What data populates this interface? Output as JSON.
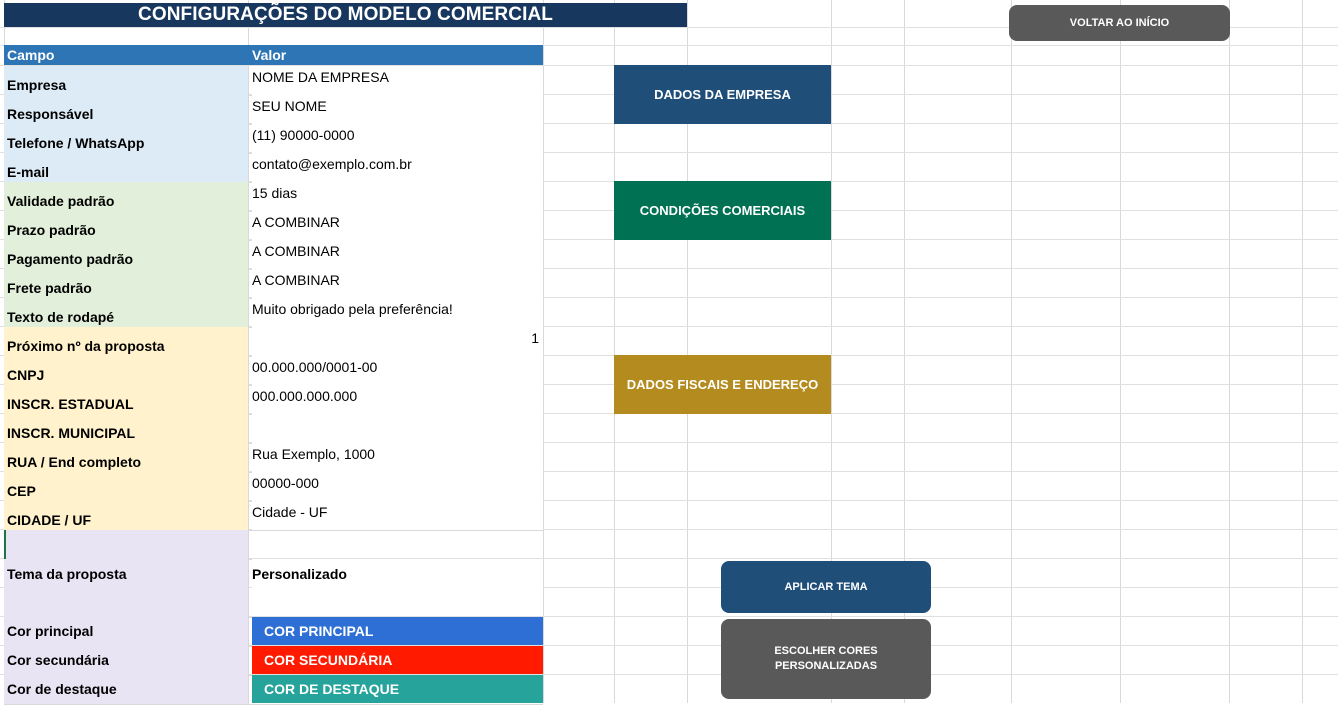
{
  "title": "CONFIGURAÇÕES DO MODELO COMERCIAL",
  "header": {
    "campo": "Campo",
    "valor": "Valor"
  },
  "fields": [
    {
      "label": "Empresa",
      "value": "NOME DA EMPRESA",
      "group": "blue"
    },
    {
      "label": "Responsável",
      "value": "SEU NOME",
      "group": "blue"
    },
    {
      "label": "Telefone / WhatsApp",
      "value": "(11) 90000-0000",
      "group": "blue"
    },
    {
      "label": "E-mail",
      "value": "contato@exemplo.com.br",
      "group": "blue"
    },
    {
      "label": "Validade padrão",
      "value": "15 dias",
      "group": "green"
    },
    {
      "label": "Prazo padrão",
      "value": "A COMBINAR",
      "group": "green"
    },
    {
      "label": "Pagamento padrão",
      "value": "A COMBINAR",
      "group": "green"
    },
    {
      "label": "Frete padrão",
      "value": "A COMBINAR",
      "group": "green"
    },
    {
      "label": "Texto de rodapé",
      "value": "Muito obrigado pela preferência!",
      "group": "green"
    },
    {
      "label": "Próximo nº da proposta",
      "value": "1",
      "group": "yellow"
    },
    {
      "label": "CNPJ",
      "value": "00.000.000/0001-00",
      "group": "yellow"
    },
    {
      "label": "INSCR. ESTADUAL",
      "value": "000.000.000.000",
      "group": "yellow"
    },
    {
      "label": "INSCR. MUNICIPAL",
      "value": "",
      "group": "yellow"
    },
    {
      "label": "RUA / End completo",
      "value": "Rua Exemplo, 1000",
      "group": "yellow"
    },
    {
      "label": "CEP",
      "value": "00000-000",
      "group": "yellow"
    },
    {
      "label": "CIDADE / UF",
      "value": "Cidade - UF",
      "group": "yellow"
    }
  ],
  "theme": {
    "label": "Tema da proposta",
    "value": "Personalizado"
  },
  "colors": [
    {
      "label": "Cor principal",
      "value": "COR PRINCIPAL",
      "color": "#2e6fd6"
    },
    {
      "label": "Cor secundária",
      "value": "COR SECUNDÁRIA",
      "color": "#ff1a00"
    },
    {
      "label": "Cor de destaque",
      "value": "COR DE DESTAQUE",
      "color": "#26a39b"
    }
  ],
  "buttons": {
    "voltar": "VOLTAR AO INÍCIO",
    "dados_empresa": "DADOS DA EMPRESA",
    "condicoes": "CONDIÇÕES COMERCIAIS",
    "fiscais": "DADOS FISCAIS E ENDEREÇO",
    "aplicar_tema": "APLICAR TEMA",
    "escolher_cores": "ESCOLHER CORES PERSONALIZADAS"
  },
  "button_colors": {
    "voltar": "#595959",
    "dados_empresa": "#1f4e79",
    "condicoes": "#007152",
    "fiscais": "#b38b1f",
    "aplicar_tema": "#1f4e79",
    "escolher_cores": "#595959"
  }
}
